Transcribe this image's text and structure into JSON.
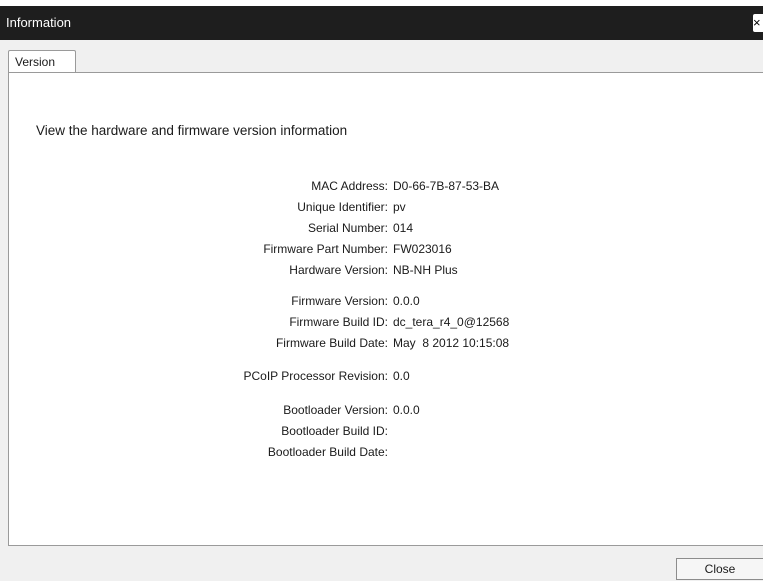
{
  "window": {
    "title": "Information",
    "close_glyph": "×"
  },
  "tabs": [
    {
      "label": "Version",
      "active": true
    }
  ],
  "panel": {
    "heading": "View the hardware and firmware version information",
    "fields": {
      "mac_address": {
        "label": "MAC Address:",
        "value": "D0-66-7B-87-53-BA"
      },
      "unique_identifier": {
        "label": "Unique Identifier:",
        "value": "pv"
      },
      "serial_number": {
        "label": "Serial Number:",
        "value": "014"
      },
      "firmware_part_number": {
        "label": "Firmware Part Number:",
        "value": "FW023016"
      },
      "hardware_version": {
        "label": "Hardware Version:",
        "value": "NB-NH Plus"
      },
      "firmware_version": {
        "label": "Firmware Version:",
        "value": "0.0.0"
      },
      "firmware_build_id": {
        "label": "Firmware Build ID:",
        "value": "dc_tera_r4_0@12568"
      },
      "firmware_build_date": {
        "label": "Firmware Build Date:",
        "value": "May  8 2012 10:15:08"
      },
      "pcoip_processor_revision": {
        "label": "PCoIP Processor Revision:",
        "value": "0.0"
      },
      "bootloader_version": {
        "label": "Bootloader Version:",
        "value": "0.0.0"
      },
      "bootloader_build_id": {
        "label": "Bootloader Build ID:",
        "value": ""
      },
      "bootloader_build_date": {
        "label": "Bootloader Build Date:",
        "value": ""
      }
    }
  },
  "footer": {
    "close_label": "Close"
  },
  "colors": {
    "titlebar": "#1e1e1e",
    "dialog_background": "#f0f0f0",
    "panel_background": "#ffffff",
    "border": "#9a9a9a"
  }
}
